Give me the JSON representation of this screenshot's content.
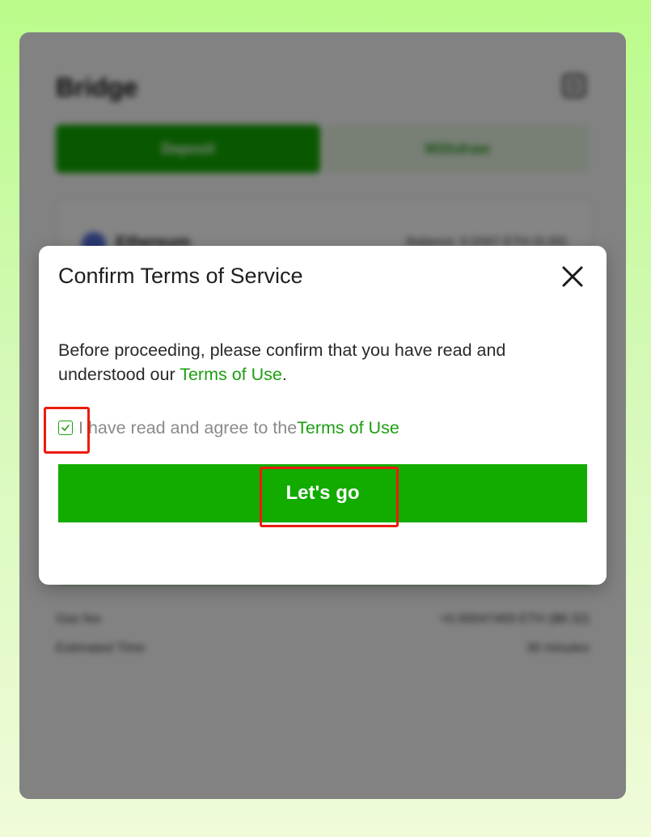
{
  "background": {
    "title": "Bridge",
    "tabs": [
      "Deposit",
      "Withdraw"
    ],
    "network": {
      "name": "Ethereum",
      "balance": "Balance: 0.0347 ETH (0.00)"
    },
    "rows": [
      {
        "label": "Gas fee",
        "value": "≈0.00047469 ETH ($8.32)"
      },
      {
        "label": "Estimated Time",
        "value": "30 minutes"
      }
    ]
  },
  "modal": {
    "title": "Confirm Terms of Service",
    "body_prefix": "Before proceeding, please confirm that you have read and understood our ",
    "body_link": "Terms of Use",
    "body_suffix": ".",
    "checkbox_checked": true,
    "agree_label": "I have read and agree to the ",
    "agree_link": "Terms of Use",
    "button_label": "Let's go"
  },
  "colors": {
    "accent": "#12ab00",
    "link": "#1e9e12",
    "highlight": "#ec1b0e"
  }
}
